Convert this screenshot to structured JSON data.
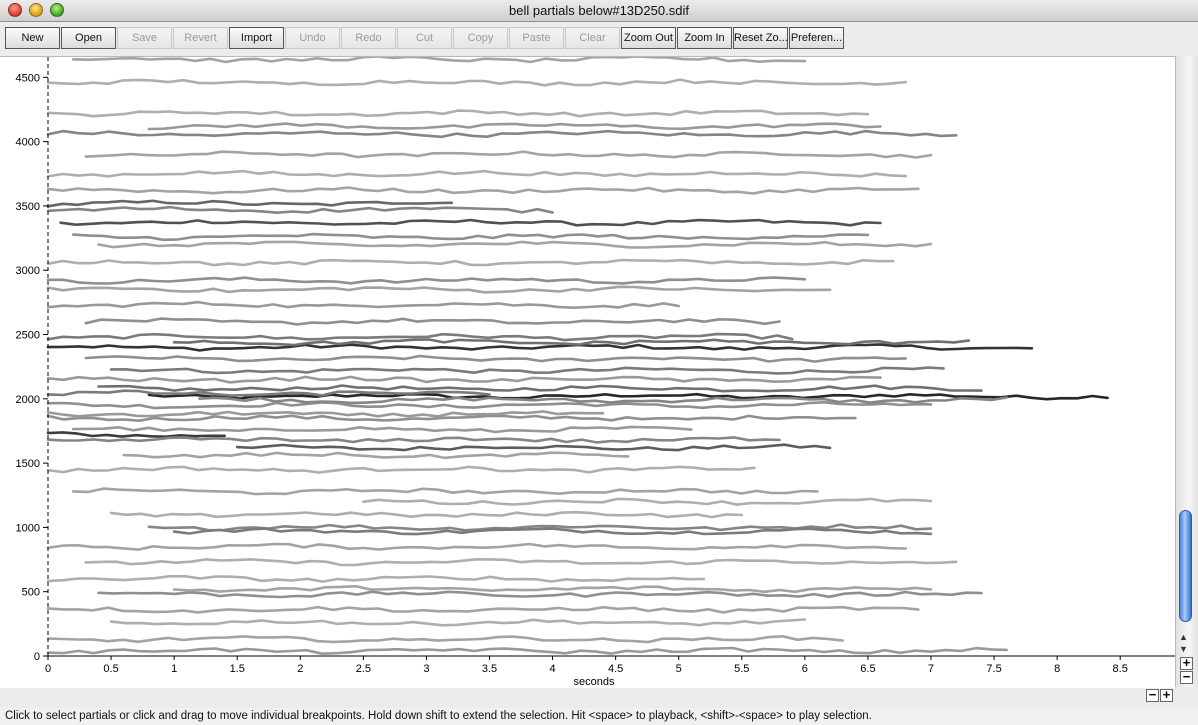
{
  "window": {
    "title": "bell partials below#13D250.sdif"
  },
  "toolbar": {
    "buttons": [
      {
        "label": "New",
        "enabled": true
      },
      {
        "label": "Open",
        "enabled": true
      },
      {
        "label": "Save",
        "enabled": false
      },
      {
        "label": "Revert",
        "enabled": false
      },
      {
        "label": "Import",
        "enabled": true
      },
      {
        "label": "Undo",
        "enabled": false
      },
      {
        "label": "Redo",
        "enabled": false
      },
      {
        "label": "Cut",
        "enabled": false
      },
      {
        "label": "Copy",
        "enabled": false
      },
      {
        "label": "Paste",
        "enabled": false
      },
      {
        "label": "Clear",
        "enabled": false
      },
      {
        "label": "Zoom Out",
        "enabled": true
      },
      {
        "label": "Zoom In",
        "enabled": true
      },
      {
        "label": "Reset Zo...",
        "enabled": true
      },
      {
        "label": "Preferen...",
        "enabled": true
      }
    ]
  },
  "plot": {
    "xlabel": "seconds",
    "xlim": [
      0,
      8.8
    ],
    "ylim": [
      0,
      4700
    ],
    "xticks": [
      "0",
      "0.5",
      "1",
      "1.5",
      "2",
      "2.5",
      "3",
      "3.5",
      "4",
      "4.5",
      "5",
      "5.5",
      "6",
      "6.5",
      "7",
      "7.5",
      "8",
      "8.5"
    ],
    "yticks": [
      "0",
      "500",
      "1000",
      "1500",
      "2000",
      "2500",
      "3000",
      "3500",
      "4000",
      "4500"
    ]
  },
  "chart_data": {
    "type": "line",
    "xlabel": "seconds",
    "ylabel": "",
    "xlim": [
      0,
      8.8
    ],
    "ylim": [
      0,
      4700
    ],
    "partials": [
      {
        "freq": 2020,
        "start": 0.8,
        "end": 8.4,
        "amp": 0.95
      },
      {
        "freq": 2400,
        "start": 0.0,
        "end": 7.8,
        "amp": 0.9
      },
      {
        "freq": 1720,
        "start": 0.0,
        "end": 1.4,
        "amp": 0.85
      },
      {
        "freq": 1620,
        "start": 1.5,
        "end": 6.2,
        "amp": 0.7
      },
      {
        "freq": 3370,
        "start": 0.1,
        "end": 6.6,
        "amp": 0.75
      },
      {
        "freq": 3520,
        "start": 0.0,
        "end": 3.2,
        "amp": 0.65
      },
      {
        "freq": 2220,
        "start": 0.5,
        "end": 7.1,
        "amp": 0.55
      },
      {
        "freq": 2080,
        "start": 0.4,
        "end": 7.4,
        "amp": 0.6
      },
      {
        "freq": 1950,
        "start": 0.0,
        "end": 7.0,
        "amp": 0.45
      },
      {
        "freq": 1850,
        "start": 0.0,
        "end": 6.4,
        "amp": 0.45
      },
      {
        "freq": 1990,
        "start": 1.2,
        "end": 7.6,
        "amp": 0.5
      },
      {
        "freq": 2480,
        "start": 0.0,
        "end": 5.9,
        "amp": 0.55
      },
      {
        "freq": 2310,
        "start": 0.3,
        "end": 6.8,
        "amp": 0.45
      },
      {
        "freq": 1760,
        "start": 0.2,
        "end": 5.1,
        "amp": 0.4
      },
      {
        "freq": 1000,
        "start": 0.8,
        "end": 7.0,
        "amp": 0.5
      },
      {
        "freq": 970,
        "start": 1.0,
        "end": 7.0,
        "amp": 0.55
      },
      {
        "freq": 2920,
        "start": 0.0,
        "end": 6.0,
        "amp": 0.45
      },
      {
        "freq": 2730,
        "start": 0.0,
        "end": 5.0,
        "amp": 0.4
      },
      {
        "freq": 2600,
        "start": 0.3,
        "end": 5.8,
        "amp": 0.45
      },
      {
        "freq": 2850,
        "start": 0.0,
        "end": 6.2,
        "amp": 0.35
      },
      {
        "freq": 4060,
        "start": 0.0,
        "end": 7.2,
        "amp": 0.5
      },
      {
        "freq": 4120,
        "start": 0.8,
        "end": 6.6,
        "amp": 0.4
      },
      {
        "freq": 3900,
        "start": 0.3,
        "end": 7.0,
        "amp": 0.35
      },
      {
        "freq": 4220,
        "start": 0.0,
        "end": 6.5,
        "amp": 0.3
      },
      {
        "freq": 4460,
        "start": 0.0,
        "end": 6.8,
        "amp": 0.3
      },
      {
        "freq": 4640,
        "start": 0.2,
        "end": 6.0,
        "amp": 0.35
      },
      {
        "freq": 3620,
        "start": 0.0,
        "end": 6.9,
        "amp": 0.35
      },
      {
        "freq": 3260,
        "start": 0.2,
        "end": 6.5,
        "amp": 0.45
      },
      {
        "freq": 3200,
        "start": 0.4,
        "end": 7.0,
        "amp": 0.35
      },
      {
        "freq": 3750,
        "start": 0.0,
        "end": 6.8,
        "amp": 0.3
      },
      {
        "freq": 1450,
        "start": 0.0,
        "end": 5.6,
        "amp": 0.3
      },
      {
        "freq": 1280,
        "start": 0.2,
        "end": 6.1,
        "amp": 0.35
      },
      {
        "freq": 1200,
        "start": 2.5,
        "end": 7.0,
        "amp": 0.3
      },
      {
        "freq": 1100,
        "start": 0.5,
        "end": 5.5,
        "amp": 0.3
      },
      {
        "freq": 850,
        "start": 0.0,
        "end": 6.8,
        "amp": 0.35
      },
      {
        "freq": 730,
        "start": 0.3,
        "end": 7.2,
        "amp": 0.3
      },
      {
        "freq": 600,
        "start": 0.0,
        "end": 5.2,
        "amp": 0.3
      },
      {
        "freq": 480,
        "start": 0.4,
        "end": 7.4,
        "amp": 0.45
      },
      {
        "freq": 520,
        "start": 1.0,
        "end": 7.0,
        "amp": 0.35
      },
      {
        "freq": 360,
        "start": 0.0,
        "end": 6.9,
        "amp": 0.35
      },
      {
        "freq": 260,
        "start": 0.5,
        "end": 6.0,
        "amp": 0.3
      },
      {
        "freq": 130,
        "start": 0.0,
        "end": 6.3,
        "amp": 0.35
      },
      {
        "freq": 40,
        "start": 0.0,
        "end": 7.6,
        "amp": 0.4
      },
      {
        "freq": 3470,
        "start": 0.0,
        "end": 4.0,
        "amp": 0.5
      },
      {
        "freq": 3060,
        "start": 0.0,
        "end": 6.7,
        "amp": 0.3
      },
      {
        "freq": 2150,
        "start": 0.0,
        "end": 6.6,
        "amp": 0.4
      },
      {
        "freq": 1560,
        "start": 0.6,
        "end": 4.6,
        "amp": 0.35
      },
      {
        "freq": 1880,
        "start": 0.0,
        "end": 4.4,
        "amp": 0.4
      },
      {
        "freq": 1680,
        "start": 0.0,
        "end": 5.8,
        "amp": 0.5
      },
      {
        "freq": 2440,
        "start": 1.0,
        "end": 7.3,
        "amp": 0.6
      },
      {
        "freq": 2040,
        "start": 0.0,
        "end": 3.5,
        "amp": 0.55
      }
    ]
  },
  "statusbar": {
    "text": "Click to select partials or click and drag to move individual breakpoints. Hold down shift to extend the selection. Hit <space> to playback, <shift>-<space> to play selection."
  },
  "controls": {
    "zoom_in_symbol": "+",
    "zoom_out_symbol": "−"
  }
}
